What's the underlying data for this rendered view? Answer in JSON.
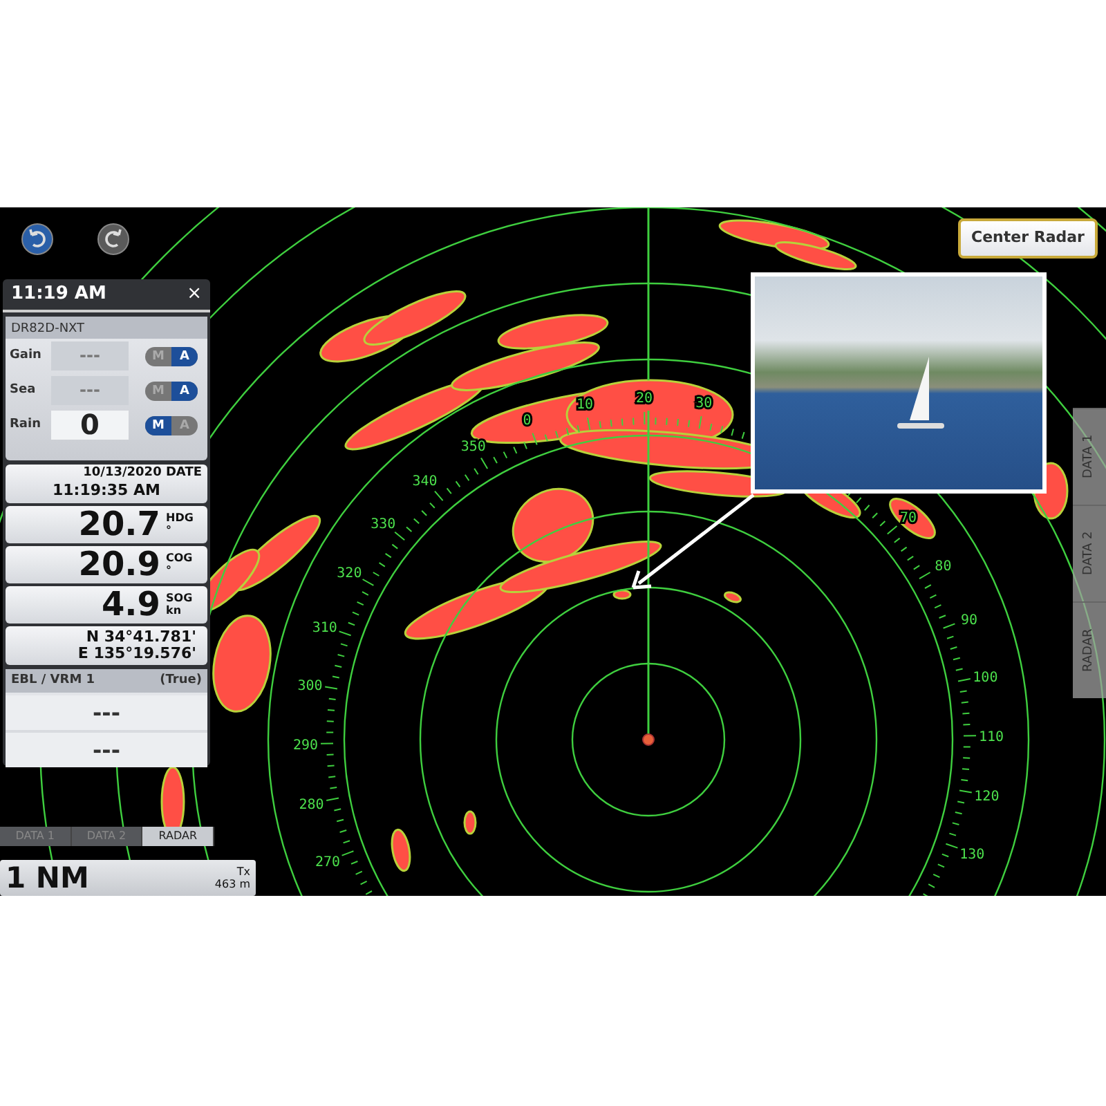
{
  "toolbar": [
    {
      "kind": "undo",
      "disabled": false
    },
    {
      "kind": "redo",
      "disabled": true
    }
  ],
  "center_radar_button": {
    "label": "Center Radar"
  },
  "panel": {
    "title": "11:19 AM",
    "close": "×",
    "radar_controls": {
      "model": "DR82D-NXT",
      "rows": [
        {
          "label": "Gain",
          "value": "---",
          "disabled": true,
          "modes": [
            {
              "label": "M",
              "selected": false
            },
            {
              "label": "A",
              "selected": true
            }
          ]
        },
        {
          "label": "Sea",
          "value": "---",
          "disabled": true,
          "modes": [
            {
              "label": "M",
              "selected": false
            },
            {
              "label": "A",
              "selected": true
            }
          ]
        },
        {
          "label": "Rain",
          "value": "0",
          "disabled": false,
          "modes": [
            {
              "label": "M",
              "selected": true
            },
            {
              "label": "A",
              "selected": false
            }
          ]
        }
      ]
    },
    "date": {
      "date": "10/13/2020",
      "label": "DATE",
      "time": "11:19:35 AM"
    },
    "readings": [
      {
        "value": "20.7",
        "label": "HDG",
        "unit": "°"
      },
      {
        "value": "20.9",
        "label": "COG",
        "unit": "°"
      },
      {
        "value": "4.9",
        "label": "SOG",
        "unit": "kn"
      }
    ],
    "position": {
      "latitude": "N 34°41.781'",
      "longitude": "E 135°19.576'"
    },
    "ebl_vrm": {
      "title": "EBL / VRM 1",
      "reference": "(True)",
      "values": [
        "---",
        "---"
      ]
    },
    "tabs": [
      {
        "label": "DATA 1",
        "selected": false
      },
      {
        "label": "DATA 2",
        "selected": false
      },
      {
        "label": "RADAR",
        "selected": true
      }
    ]
  },
  "range": {
    "value": "1 NM",
    "mode": "Tx",
    "distance": "463 m"
  },
  "side_tabs": [
    {
      "label": "DATA 1",
      "selected": false
    },
    {
      "label": "DATA 2",
      "selected": false
    },
    {
      "label": "RADAR",
      "selected": false
    }
  ],
  "radar": {
    "bearing_labels": [
      "10",
      "20",
      "30",
      "0",
      "350",
      "340",
      "70",
      "330",
      "80",
      "320",
      "90",
      "310",
      "100",
      "300",
      "110",
      "290",
      "120",
      "280",
      "130",
      "270"
    ]
  }
}
